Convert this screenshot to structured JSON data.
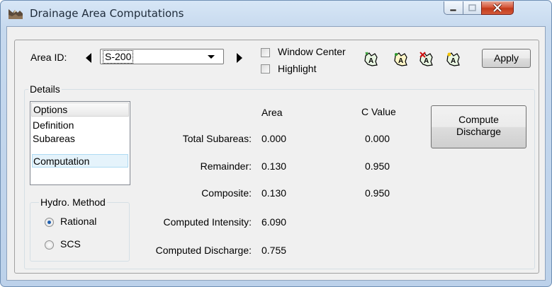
{
  "window": {
    "title": "Drainage Area Computations"
  },
  "toolbar": {
    "area_id_label": "Area ID:",
    "area_id_value": "S-200",
    "window_center_label": "Window Center",
    "window_center_checked": false,
    "highlight_label": "Highlight",
    "highlight_checked": false,
    "apply_label": "Apply",
    "icons": [
      "area-add-icon",
      "area-edit-icon",
      "area-delete-icon",
      "area-locate-icon"
    ]
  },
  "details": {
    "group_label": "Details",
    "options_header": "Options",
    "options": [
      "Definition",
      "Subareas",
      "Computation"
    ],
    "selected_option": "Computation",
    "hydro_method_label": "Hydro. Method",
    "methods": [
      "Rational",
      "SCS"
    ],
    "selected_method": "Rational",
    "columns": {
      "area": "Area",
      "c_value": "C Value"
    },
    "rows": [
      {
        "label": "Total Subareas:",
        "area": "0.000",
        "c_value": "0.000"
      },
      {
        "label": "Remainder:",
        "area": "0.130",
        "c_value": "0.950"
      },
      {
        "label": "Composite:",
        "area": "0.130",
        "c_value": "0.950"
      },
      {
        "label": "Computed Intensity:",
        "area": "6.090",
        "c_value": ""
      },
      {
        "label": "Computed Discharge:",
        "area": "0.755",
        "c_value": ""
      }
    ],
    "compute_button_line1": "Compute",
    "compute_button_line2": "Discharge"
  },
  "colors": {
    "title_bar": "#c6d9ee",
    "close_button": "#c23a1b",
    "selection": "#e5f3fb",
    "radio_dot": "#1f5fae"
  }
}
